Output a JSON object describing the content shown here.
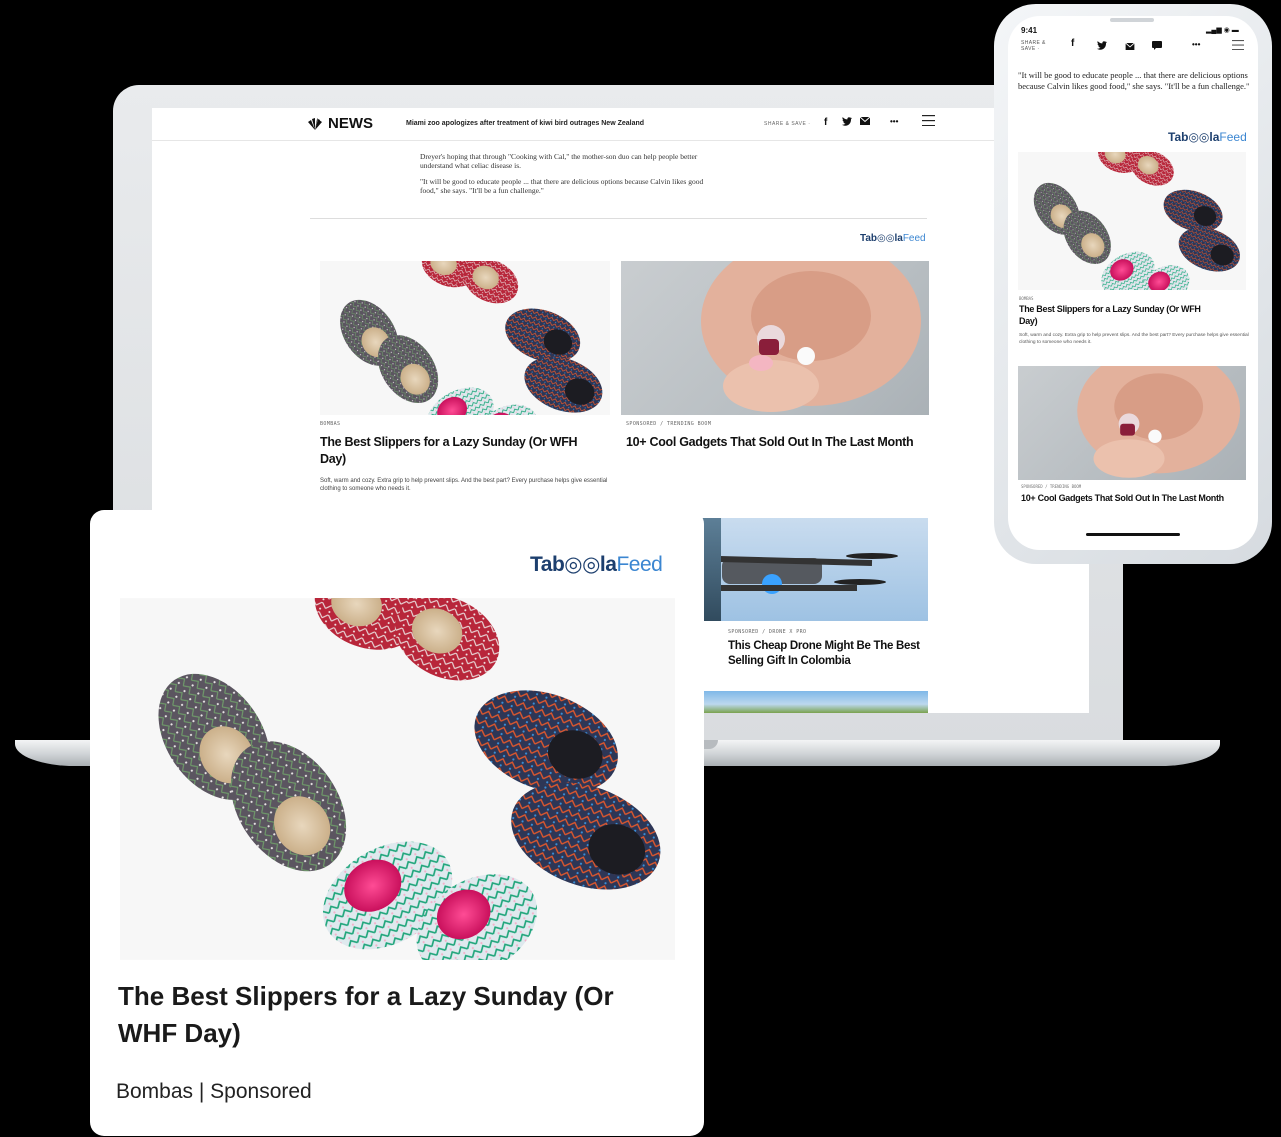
{
  "laptop": {
    "header": {
      "logo_text": "NEWS",
      "ticker": "Miami zoo apologizes after treatment of kiwi bird outrages New Zealand",
      "share_save": "SHARE & SAVE ·",
      "icons": [
        "facebook-icon",
        "twitter-icon",
        "mail-icon",
        "more-icon",
        "menu-icon"
      ],
      "more_label": "•••"
    },
    "article": {
      "paragraph_1": "Dreyer's hoping that through \"Cooking with Cal,\" the mother-son duo can help people better understand what celiac disease is.",
      "paragraph_2": "\"It will be good to educate people ... that there are delicious options because Calvin likes good food,\" she says. \"It'll be a fun challenge.\""
    },
    "taboola": {
      "bold": "Tab◎◎la",
      "light": "Feed"
    },
    "cards": [
      {
        "kicker": "BOMBAS",
        "title": "The Best Slippers for a Lazy Sunday (Or WFH Day)",
        "description": "Soft, warm and cozy. Extra grip to help prevent slips. And the best part? Every purchase helps give essential clothing to someone who needs it."
      },
      {
        "kicker": "SPONSORED / TRENDING BOOM",
        "title": "10+ Cool Gadgets That Sold Out In The Last Month"
      },
      {
        "kicker": "SPONSORED / DRONE X PRO",
        "title": "This Cheap Drone Might Be The Best Selling Gift In Colombia"
      }
    ]
  },
  "phone": {
    "time": "9:41",
    "status": "▂▄▆ ◉ ▬",
    "share_save_1": "SHARE &",
    "share_save_2": "SAVE ·",
    "more_label": "•••",
    "article_text": "\"It will be good to educate people ... that there are delicious options because Calvin likes good food,\" she says. \"It'll be a fun challenge.\"",
    "taboola": {
      "bold": "Tab◎◎la",
      "light": "Feed"
    },
    "cards": [
      {
        "kicker": "BOMBAS",
        "title": "The Best Slippers for a Lazy Sunday (Or WFH Day)",
        "description": "Soft, warm and cozy. Extra grip to help prevent slips. And the best part? Every purchase helps give essential clothing to someone who needs it."
      },
      {
        "kicker": "SPONSORED / TRENDING BOOM",
        "title": "10+ Cool Gadgets That Sold Out In The Last Month"
      }
    ]
  },
  "feature_card": {
    "taboola": {
      "bold": "Tab◎◎la",
      "light": "Feed"
    },
    "title": "The Best Slippers for a Lazy Sunday (Or WHF Day)",
    "source": "Bombas | Sponsored"
  },
  "colors": {
    "background": "#000000",
    "taboola_dark": "#1d3f6e",
    "taboola_light": "#3b86d1",
    "slipper_red": "#b8263a",
    "slipper_grey": "#5b5560",
    "slipper_navy": "#2d3656",
    "slipper_pink": "#e8186b"
  }
}
